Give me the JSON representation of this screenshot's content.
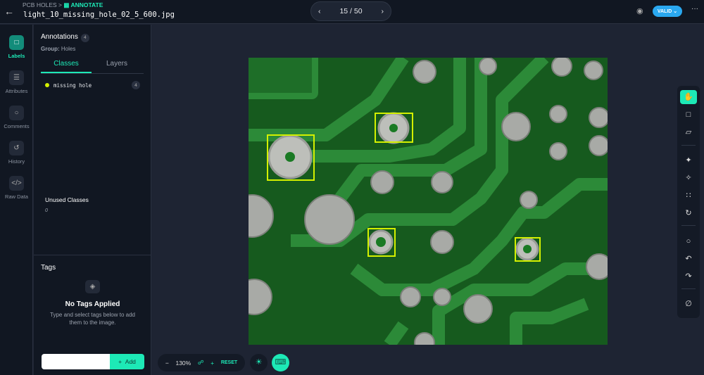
{
  "header": {
    "breadcrumb_project": "PCB HOLES",
    "breadcrumb_separator": ">",
    "breadcrumb_current": "ANNOTATE",
    "filename": "light_10_missing_hole_02_5_600.jpg",
    "pager": "15 / 50",
    "status": "VALID"
  },
  "rail": [
    {
      "label": "Labels",
      "icon": "label-icon",
      "active": true
    },
    {
      "label": "Attributes",
      "icon": "list-icon"
    },
    {
      "label": "Comments",
      "icon": "comment-icon"
    },
    {
      "label": "History",
      "icon": "history-icon"
    },
    {
      "label": "Raw Data",
      "icon": "code-icon"
    }
  ],
  "panel": {
    "title": "Annotations",
    "count": "4",
    "group_label": "Group:",
    "group": "Holes",
    "tabs": [
      "Classes",
      "Layers"
    ],
    "classes": [
      {
        "name": "missing hole",
        "count": "4",
        "color": "#d4f000"
      }
    ],
    "unused_title": "Unused Classes",
    "unused_count": "0"
  },
  "tags": {
    "title": "Tags",
    "empty_title": "No Tags Applied",
    "empty_desc": "Type and select tags below to add them to the image.",
    "input_value": "",
    "add_label": "Add"
  },
  "zoom": {
    "level": "130%",
    "reset": "RESET"
  },
  "annotations": [
    {
      "class": "missing hole"
    },
    {
      "class": "missing hole"
    },
    {
      "class": "missing hole"
    },
    {
      "class": "missing hole"
    }
  ],
  "colors": {
    "accent": "#1de9b6",
    "bbox": "#d4f000",
    "valid": "#2aa8f0"
  }
}
